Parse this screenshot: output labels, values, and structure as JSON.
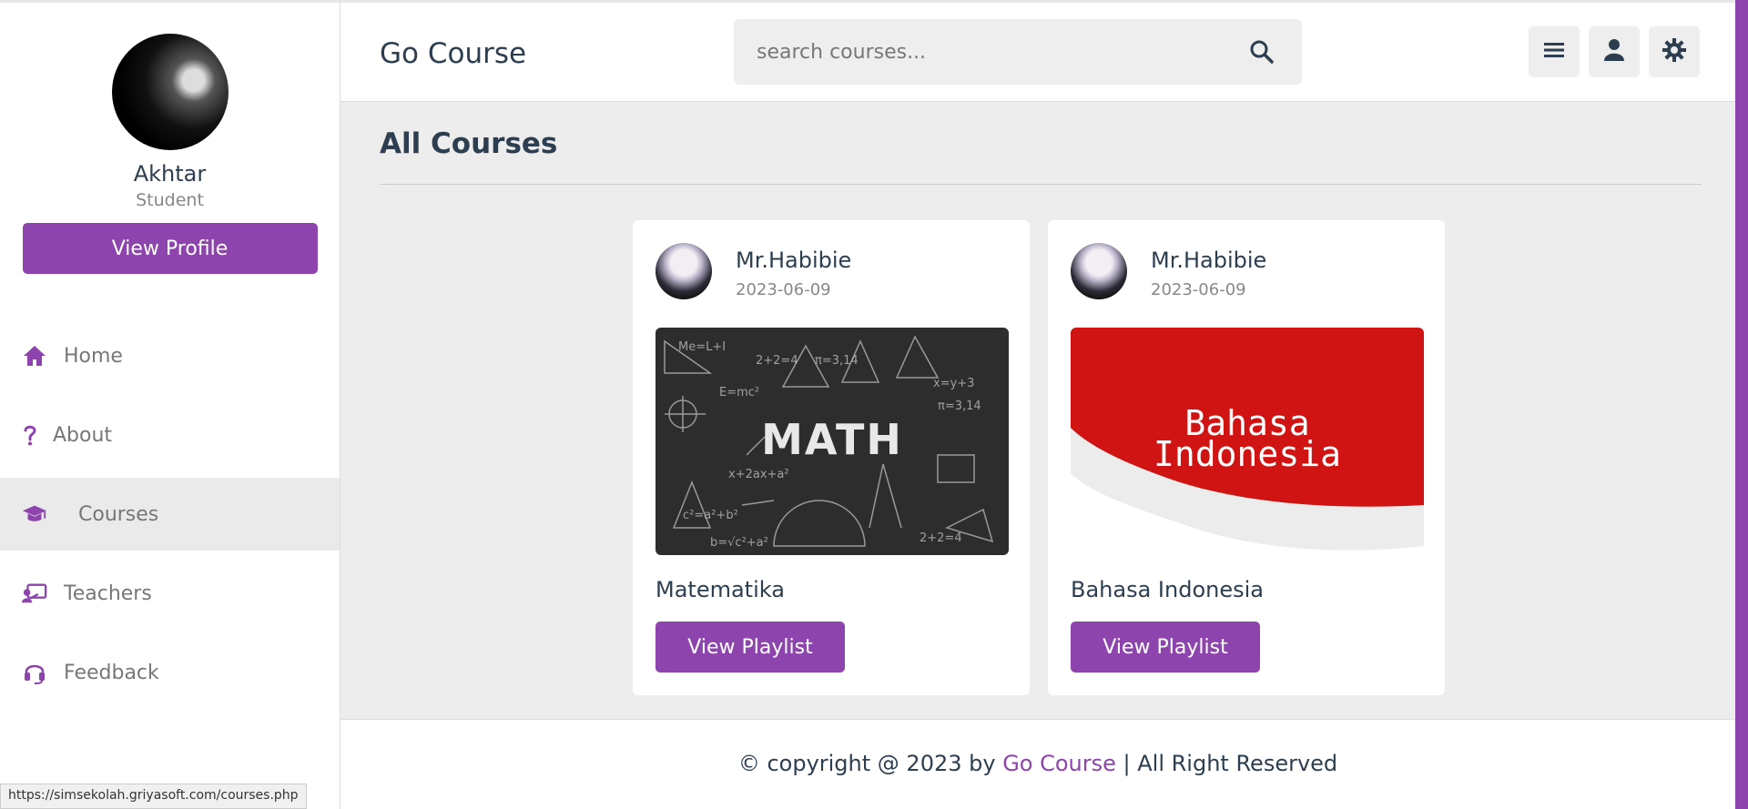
{
  "header": {
    "logo": "Go Course",
    "search_placeholder": "search courses..."
  },
  "profile": {
    "name": "Akhtar",
    "role": "Student",
    "button": "View Profile"
  },
  "nav": [
    {
      "label": "Home",
      "icon": "home-icon"
    },
    {
      "label": "About",
      "icon": "question-icon"
    },
    {
      "label": "Courses",
      "icon": "graduation-cap-icon",
      "active": true
    },
    {
      "label": "Teachers",
      "icon": "chalkboard-teacher-icon"
    },
    {
      "label": "Feedback",
      "icon": "headset-icon"
    }
  ],
  "main": {
    "title": "All Courses",
    "courses": [
      {
        "tutor": "Mr.Habibie",
        "date": "2023-06-09",
        "title": "Matematika",
        "thumb_text": "MATH",
        "button": "View Playlist"
      },
      {
        "tutor": "Mr.Habibie",
        "date": "2023-06-09",
        "title": "Bahasa Indonesia",
        "thumb_text_line1": "Bahasa",
        "thumb_text_line2": "Indonesia",
        "button": "View Playlist"
      }
    ]
  },
  "footer": {
    "prefix": "© copyright @ 2023 by ",
    "brand": "Go Course",
    "suffix": " | All Right Reserved"
  },
  "status_bar_url": "https://simsekolah.griyasoft.com/courses.php",
  "colors": {
    "accent": "#8e44ad",
    "text": "#2c3e50",
    "bi_red": "#d01414"
  }
}
